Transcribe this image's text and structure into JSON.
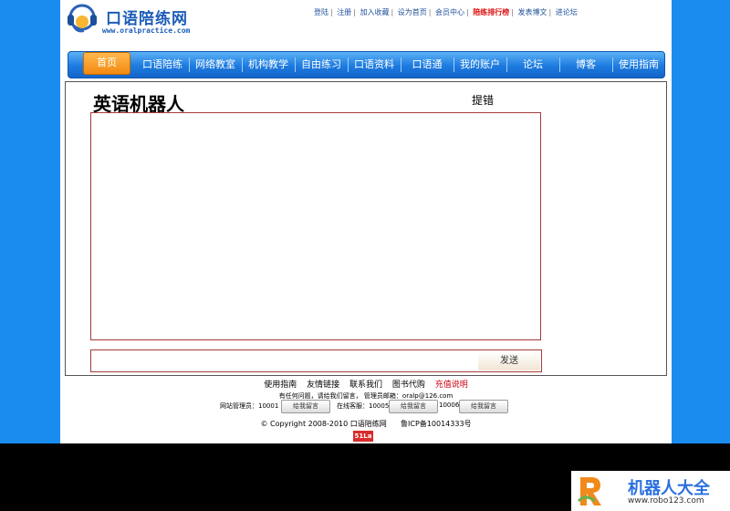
{
  "site": {
    "title": "口语陪练网",
    "url": "www.oralpractice.com"
  },
  "toplinks": [
    "登陆",
    "注册",
    "加入收藏",
    "设为首页",
    "会员中心",
    "陪练排行榜",
    "发表博文",
    "进论坛"
  ],
  "nav": {
    "home": "首页",
    "items": [
      "口语陪练",
      "网络教室",
      "机构教学",
      "自由练习",
      "口语资料",
      "口语通",
      "我的账户",
      "论坛",
      "博客",
      "使用指南"
    ]
  },
  "main": {
    "title": "英语机器人",
    "report_label": "提错",
    "input_value": "",
    "send_label": "发送"
  },
  "footer": {
    "links": [
      "使用指南",
      "友情链接",
      "联系我们",
      "图书代购",
      "充值说明"
    ],
    "contact_line": "有任何问题，请给我们留言， 管理员邮箱：oralp@126.com",
    "admins": [
      {
        "label": "网站管理员：10001",
        "badge": "给我留言"
      },
      {
        "label": "在线客服：10005",
        "badge": "给我留言"
      },
      {
        "label": "10006",
        "badge": "给我留言"
      }
    ],
    "copyright": "© Copyright 2008-2010 口语陪练网",
    "icp": "鲁ICP备10014333号",
    "counter": "51La"
  },
  "watermark": {
    "title": "机器人大全",
    "url": "www.robo123.com"
  },
  "colors": {
    "side_background": "#1a8cf0",
    "nav_blue": "#1d7be0",
    "home_orange": "#f38a10",
    "box_border": "#a63a3a",
    "link_blue": "#1d4f9a",
    "highlight_red": "#d11111"
  }
}
